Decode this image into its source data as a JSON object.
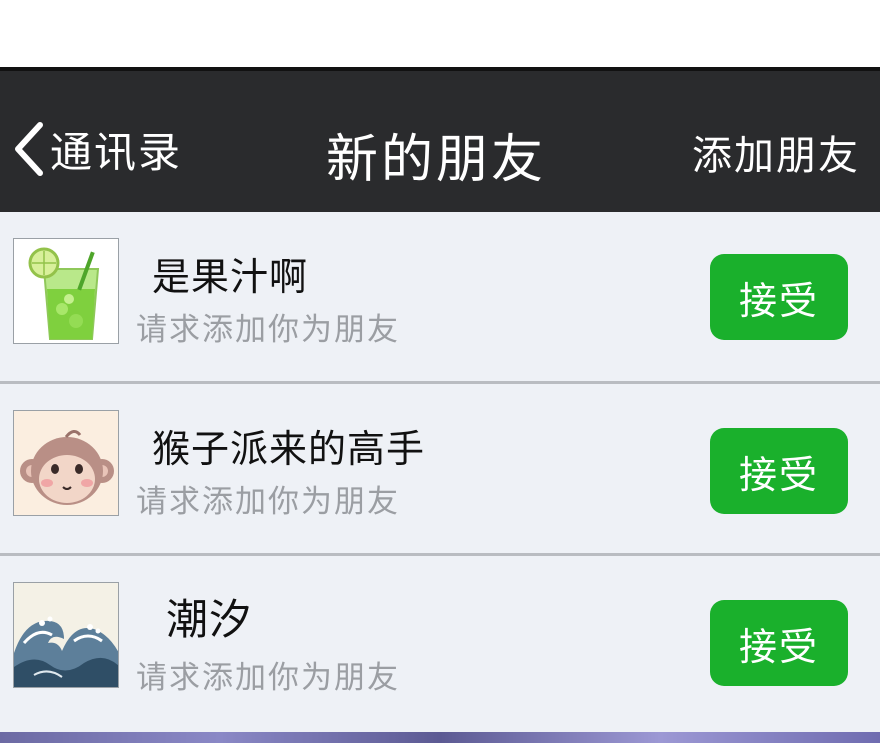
{
  "header": {
    "back_label": "通讯录",
    "title": "新的朋友",
    "add_friend_label": "添加朋友"
  },
  "requests": [
    {
      "name": "是果汁啊",
      "subtitle": "请求添加你为朋友",
      "accept_label": "接受",
      "avatar_icon": "green-juice-drink-icon"
    },
    {
      "name": "猴子派来的高手",
      "subtitle": "请求添加你为朋友",
      "accept_label": "接受",
      "avatar_icon": "monkey-face-icon"
    },
    {
      "name": "潮汐",
      "subtitle": "请求添加你为朋友",
      "accept_label": "接受",
      "avatar_icon": "ocean-wave-icon"
    }
  ],
  "colors": {
    "navbar": "#2a2b2d",
    "list_background": "#eef1f6",
    "accept_button": "#1ab02c",
    "subtext": "#9b9ea3"
  }
}
